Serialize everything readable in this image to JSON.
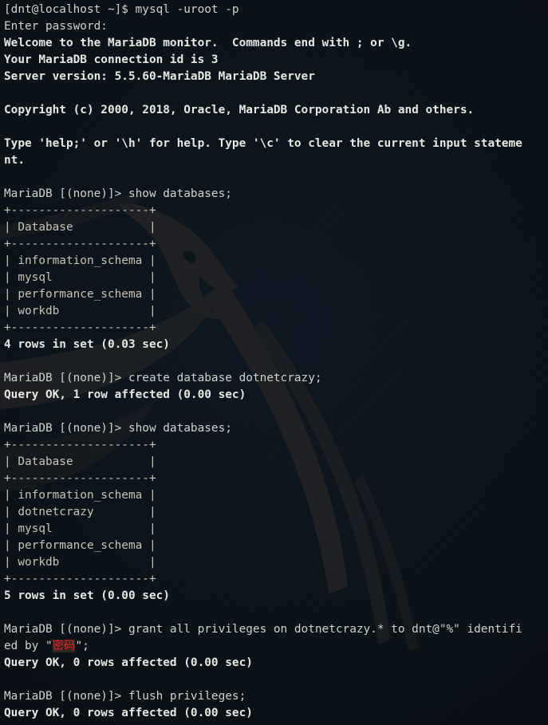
{
  "terminal": {
    "app": "MariaDB monitor session",
    "shell_prompt": "[dnt@localhost ~]$",
    "db_prompt": "MariaDB [(none)]>",
    "colors": {
      "background": "#0a1219",
      "foreground": "#d4d8d2",
      "bold_foreground": "#e6e9e3",
      "table_rule": "#c8c3b4",
      "redacted_text": "#f02020",
      "redacted_block": "#2e2623",
      "watermark": "#1f2124"
    },
    "watermark_icon": "kali-dragon-logo",
    "lines": [
      {
        "id": "l01",
        "text": "[dnt@localhost ~]$ mysql -uroot -p",
        "style": "sh"
      },
      {
        "id": "l02",
        "text": "Enter password:",
        "style": "sh"
      },
      {
        "id": "l03",
        "text": "Welcome to the MariaDB monitor.  Commands end with ; or \\g.",
        "style": "bold"
      },
      {
        "id": "l04",
        "text": "Your MariaDB connection id is 3",
        "style": "bold"
      },
      {
        "id": "l05",
        "text": "Server version: 5.5.60-MariaDB MariaDB Server",
        "style": "bold"
      },
      {
        "id": "l06",
        "text": "",
        "style": "blank"
      },
      {
        "id": "l07",
        "text": "Copyright (c) 2000, 2018, Oracle, MariaDB Corporation Ab and others.",
        "style": "bold"
      },
      {
        "id": "l08",
        "text": "",
        "style": "blank"
      },
      {
        "id": "l09",
        "text": "Type 'help;' or '\\h' for help. Type '\\c' to clear the current input stateme",
        "style": "bold"
      },
      {
        "id": "l10",
        "text": "nt.",
        "style": "bold"
      },
      {
        "id": "l11",
        "text": "",
        "style": "blank"
      },
      {
        "id": "l12",
        "text": "MariaDB [(none)]> show databases;",
        "style": "sh"
      },
      {
        "id": "l13",
        "text": "+--------------------+",
        "style": "tbl"
      },
      {
        "id": "l14",
        "text": "| Database           |",
        "style": "tbl"
      },
      {
        "id": "l15",
        "text": "+--------------------+",
        "style": "tbl"
      },
      {
        "id": "l16",
        "text": "| information_schema |",
        "style": "tbl"
      },
      {
        "id": "l17",
        "text": "| mysql              |",
        "style": "tbl"
      },
      {
        "id": "l18",
        "text": "| performance_schema |",
        "style": "tbl"
      },
      {
        "id": "l19",
        "text": "| workdb             |",
        "style": "tbl"
      },
      {
        "id": "l20",
        "text": "+--------------------+",
        "style": "tbl"
      },
      {
        "id": "l21",
        "text": "4 rows in set (0.03 sec)",
        "style": "bold"
      },
      {
        "id": "l22",
        "text": "",
        "style": "blank"
      },
      {
        "id": "l23",
        "text": "MariaDB [(none)]> create database dotnetcrazy;",
        "style": "sh"
      },
      {
        "id": "l24",
        "text": "Query OK, 1 row affected (0.00 sec)",
        "style": "bold"
      },
      {
        "id": "l25",
        "text": "",
        "style": "blank"
      },
      {
        "id": "l26",
        "text": "MariaDB [(none)]> show databases;",
        "style": "sh"
      },
      {
        "id": "l27",
        "text": "+--------------------+",
        "style": "tbl"
      },
      {
        "id": "l28",
        "text": "| Database           |",
        "style": "tbl"
      },
      {
        "id": "l29",
        "text": "+--------------------+",
        "style": "tbl"
      },
      {
        "id": "l30",
        "text": "| information_schema |",
        "style": "tbl"
      },
      {
        "id": "l31",
        "text": "| dotnetcrazy        |",
        "style": "tbl"
      },
      {
        "id": "l32",
        "text": "| mysql              |",
        "style": "tbl"
      },
      {
        "id": "l33",
        "text": "| performance_schema |",
        "style": "tbl"
      },
      {
        "id": "l34",
        "text": "| workdb             |",
        "style": "tbl"
      },
      {
        "id": "l35",
        "text": "+--------------------+",
        "style": "tbl"
      },
      {
        "id": "l36",
        "text": "5 rows in set (0.00 sec)",
        "style": "bold"
      },
      {
        "id": "l37",
        "text": "",
        "style": "blank"
      },
      {
        "id": "l38",
        "text": "MariaDB [(none)]> grant all privileges on dotnetcrazy.* to dnt@\"%\" identifi",
        "style": "sh"
      },
      {
        "id": "l39",
        "segments": [
          {
            "text": "ed by \"",
            "style": "sh"
          },
          {
            "text": "密码",
            "style": "redacted"
          },
          {
            "text": "\";",
            "style": "sh"
          }
        ]
      },
      {
        "id": "l40",
        "text": "Query OK, 0 rows affected (0.00 sec)",
        "style": "bold"
      },
      {
        "id": "l41",
        "text": "",
        "style": "blank"
      },
      {
        "id": "l42",
        "text": "MariaDB [(none)]> flush privileges;",
        "style": "sh"
      },
      {
        "id": "l43",
        "text": "Query OK, 0 rows affected (0.00 sec)",
        "style": "bold"
      }
    ]
  },
  "session_summary": {
    "client_command": "mysql -uroot -p",
    "server_version": "5.5.60-MariaDB MariaDB Server",
    "connection_id": "3",
    "databases_before": [
      "information_schema",
      "mysql",
      "performance_schema",
      "workdb"
    ],
    "databases_after": [
      "information_schema",
      "dotnetcrazy",
      "mysql",
      "performance_schema",
      "workdb"
    ],
    "rows_before": "4 rows in set (0.03 sec)",
    "rows_after": "5 rows in set (0.00 sec)",
    "created_database": "dotnetcrazy",
    "granted_user": "dnt@\"%\"",
    "redacted_password": "密码"
  }
}
